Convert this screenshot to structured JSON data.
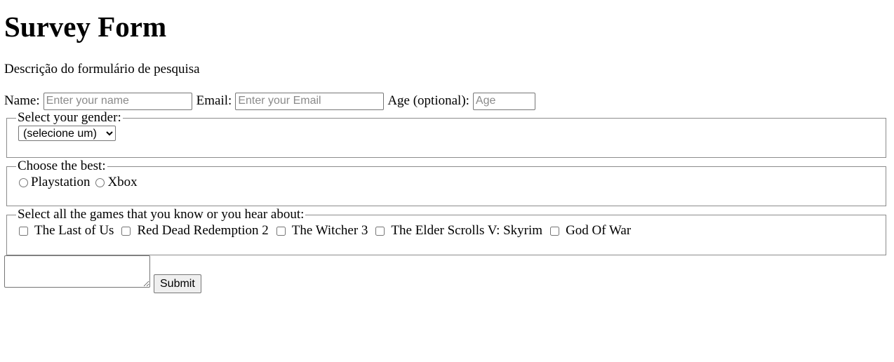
{
  "page": {
    "title": "Survey Form",
    "description": "Descrição do formulário de pesquisa"
  },
  "fields": {
    "name": {
      "label": "Name:",
      "placeholder": "Enter your name",
      "value": ""
    },
    "email": {
      "label": "Email:",
      "placeholder": "Enter your Email",
      "value": ""
    },
    "age": {
      "label": "Age (optional):",
      "placeholder": "Age",
      "value": ""
    }
  },
  "gender": {
    "legend": "Select your gender:",
    "selected": "(selecione um)"
  },
  "console": {
    "legend": "Choose the best:",
    "options": [
      "Playstation",
      "Xbox"
    ]
  },
  "games": {
    "legend": "Select all the games that you know or you hear about:",
    "options": [
      "The Last of Us",
      "Red Dead Redemption 2",
      "The Witcher 3",
      "The Elder Scrolls V: Skyrim",
      "God Of War"
    ]
  },
  "comments": {
    "value": ""
  },
  "submit": {
    "label": "Submit"
  },
  "colors": {
    "border": "#767676",
    "fieldset_border": "#8c8c8c",
    "button_bg": "#efefef",
    "placeholder": "#8a8a8a"
  }
}
